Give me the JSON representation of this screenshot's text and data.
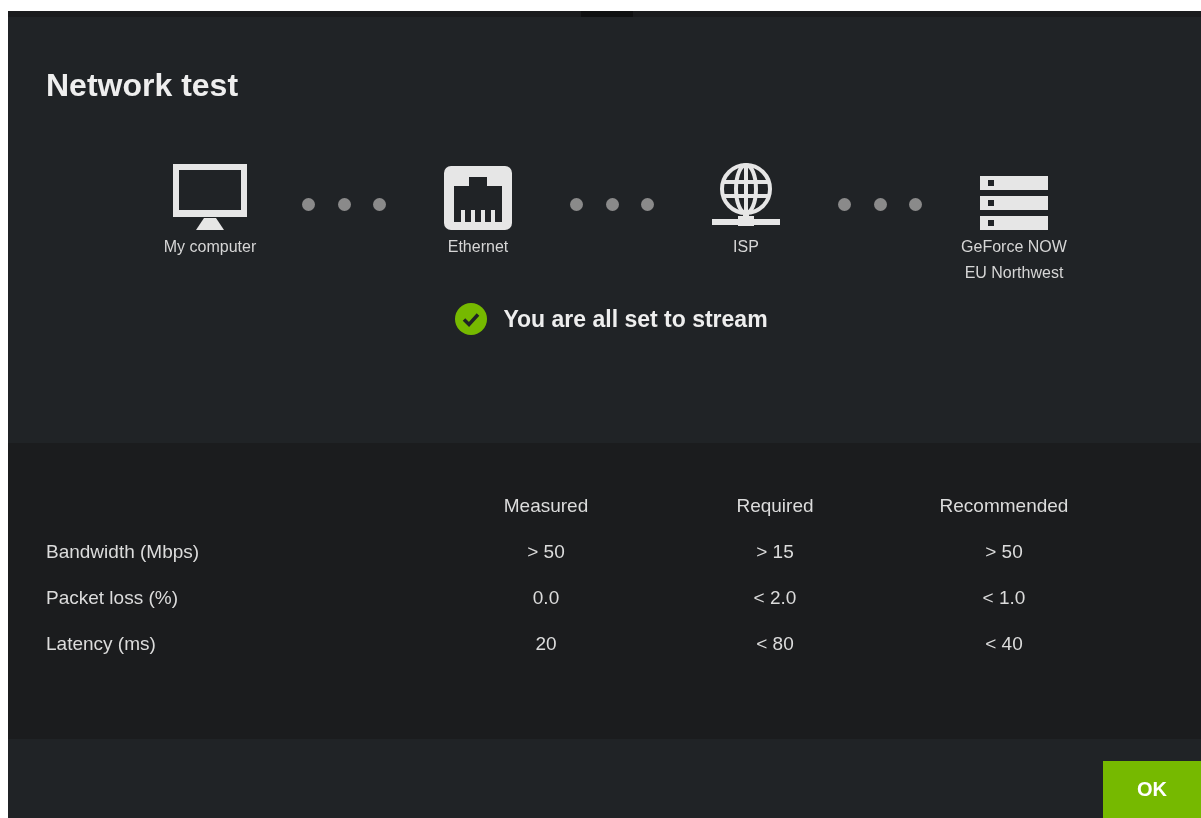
{
  "dialog": {
    "title": "Network test"
  },
  "path": [
    {
      "kind": "computer",
      "label": "My computer"
    },
    {
      "kind": "ethernet",
      "label": "Ethernet"
    },
    {
      "kind": "globe",
      "label": "ISP"
    },
    {
      "kind": "server",
      "label": "GeForce NOW\nEU Northwest"
    }
  ],
  "status": {
    "kind": "success",
    "text": "You are all set to stream"
  },
  "table": {
    "columns": [
      "Measured",
      "Required",
      "Recommended"
    ],
    "rows": [
      {
        "label": "Bandwidth (Mbps)",
        "values": [
          "> 50",
          "> 15",
          "> 50"
        ]
      },
      {
        "label": "Packet loss (%)",
        "values": [
          "0.0",
          "< 2.0",
          "< 1.0"
        ]
      },
      {
        "label": "Latency (ms)",
        "values": [
          "20",
          "< 80",
          "< 40"
        ]
      }
    ]
  },
  "buttons": [
    {
      "kind": "primary",
      "label": "OK"
    }
  ]
}
